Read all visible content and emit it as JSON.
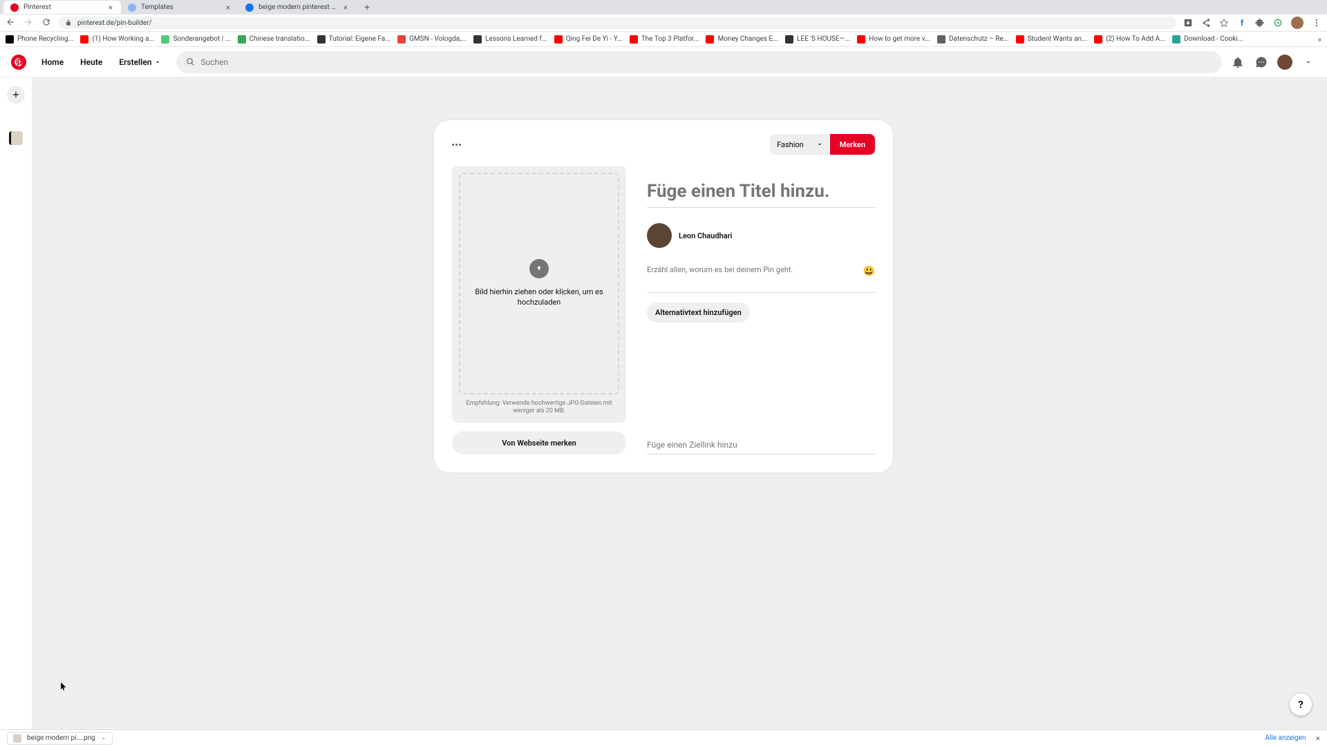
{
  "browser": {
    "tabs": [
      {
        "title": "Pinterest",
        "favicon": "#e60023",
        "active": true
      },
      {
        "title": "Templates",
        "favicon": "#8ab4f8",
        "active": false
      },
      {
        "title": "beige modern pinterest pin - F...",
        "favicon": "#1a73e8",
        "active": false
      }
    ],
    "url": "pinterest.de/pin-builder/",
    "bookmarks": [
      {
        "label": "Phone Recycling...",
        "color": "#000"
      },
      {
        "label": "(1) How Working a...",
        "color": "#f00"
      },
      {
        "label": "Sonderangebot | ...",
        "color": "#4ecb71"
      },
      {
        "label": "Chinese translatio...",
        "color": "#34a853"
      },
      {
        "label": "Tutorial: Eigene Fa...",
        "color": "#333"
      },
      {
        "label": "GMSN - Vologda,...",
        "color": "#ea4335"
      },
      {
        "label": "Lessons Learned f...",
        "color": "#333"
      },
      {
        "label": "Qing Fei De Yi - Y...",
        "color": "#f00"
      },
      {
        "label": "The Top 3 Platfor...",
        "color": "#f00"
      },
      {
        "label": "Money Changes E...",
        "color": "#f00"
      },
      {
        "label": "LEE 'S HOUSE—...",
        "color": "#333"
      },
      {
        "label": "How to get more v...",
        "color": "#f00"
      },
      {
        "label": "Datenschutz – Re...",
        "color": "#5f6368"
      },
      {
        "label": "Student Wants an...",
        "color": "#f00"
      },
      {
        "label": "(2) How To Add A...",
        "color": "#f00"
      },
      {
        "label": "Download - Cooki...",
        "color": "#26a69a"
      }
    ]
  },
  "header": {
    "nav": {
      "home": "Home",
      "today": "Heute",
      "create": "Erstellen"
    },
    "search_placeholder": "Suchen"
  },
  "builder": {
    "board": "Fashion",
    "save": "Merken",
    "upload_text": "Bild hierhin ziehen oder klicken, um es hochzuladen",
    "upload_hint": "Empfehlung: Verwende hochwertige JPG-Dateien mit weniger als 20 MB.",
    "from_web": "Von Webseite merken",
    "title_placeholder": "Füge einen Titel hinzu.",
    "author": "Leon Chaudhari",
    "desc_placeholder": "Erzähl allen, worum es bei deinem Pin geht.",
    "alt_text": "Alternativtext hinzufügen",
    "link_placeholder": "Füge einen Ziellink hinzu",
    "emoji": "😃"
  },
  "help": "?",
  "download": {
    "file": "beige modern pi....png",
    "show_all": "Alle anzeigen"
  }
}
